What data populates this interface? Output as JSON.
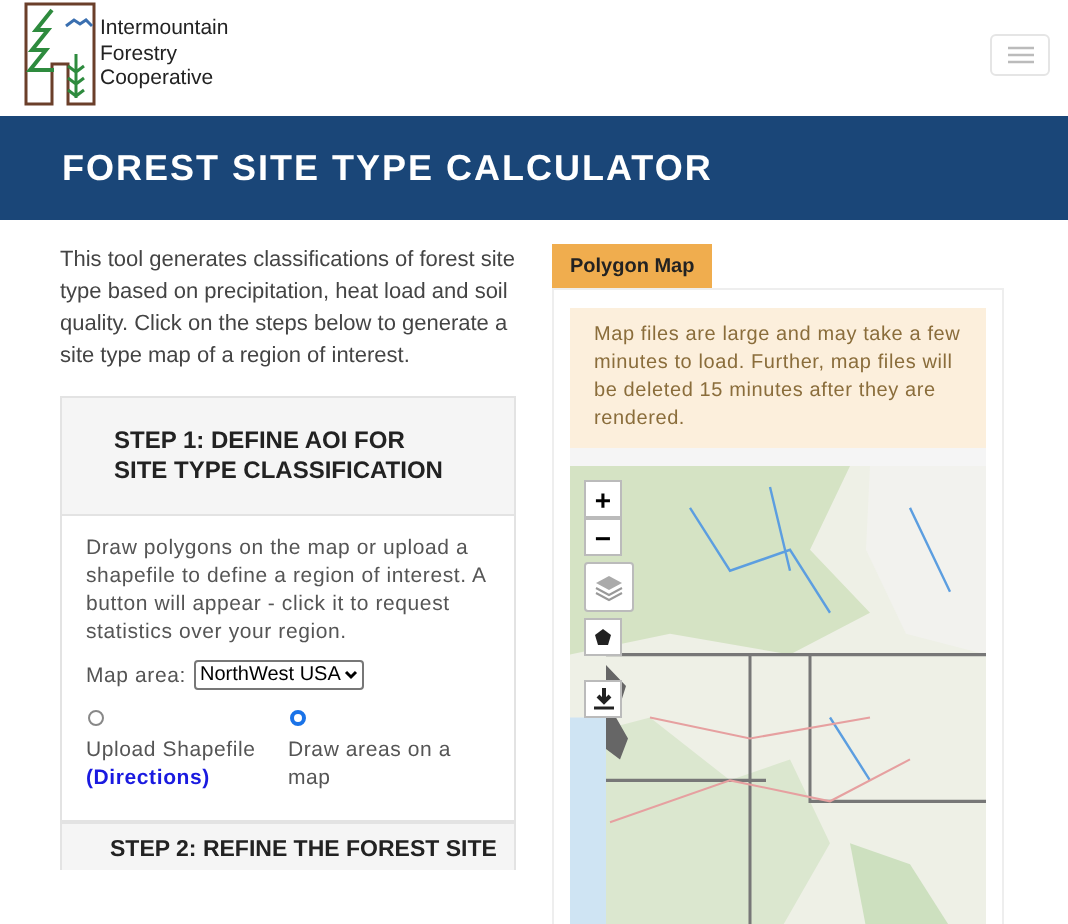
{
  "logo": {
    "lines": [
      "Intermountain",
      "Forestry",
      "Cooperative"
    ]
  },
  "banner": {
    "title": "FOREST SITE TYPE CALCULATOR"
  },
  "intro": "This tool generates classifications of forest site type based on precipitation, heat load and soil quality. Click on the steps below to generate a site type map of a region of interest.",
  "steps": [
    {
      "title": "STEP 1: DEFINE AOI FOR SITE TYPE CLASSIFICATION",
      "expanded": true,
      "description": "Draw polygons on the map or upload a shapefile to define a region of interest. A button will appear - click it to request statistics over your region.",
      "map_area": {
        "label": "Map area:",
        "value": "NorthWest USA"
      },
      "options": [
        {
          "label": "Upload Shapefile",
          "link": "(Directions)",
          "selected": false
        },
        {
          "label": "Draw areas on a map",
          "selected": true
        }
      ]
    },
    {
      "title": "STEP 2: REFINE THE FOREST SITE",
      "expanded": false
    }
  ],
  "map_panel": {
    "tab": "Polygon Map",
    "notice": "Map files are large and may take a few minutes to load. Further, map files will be deleted 15 minutes after they are rendered.",
    "controls": {
      "zoom_in": "+",
      "zoom_out": "−"
    }
  }
}
